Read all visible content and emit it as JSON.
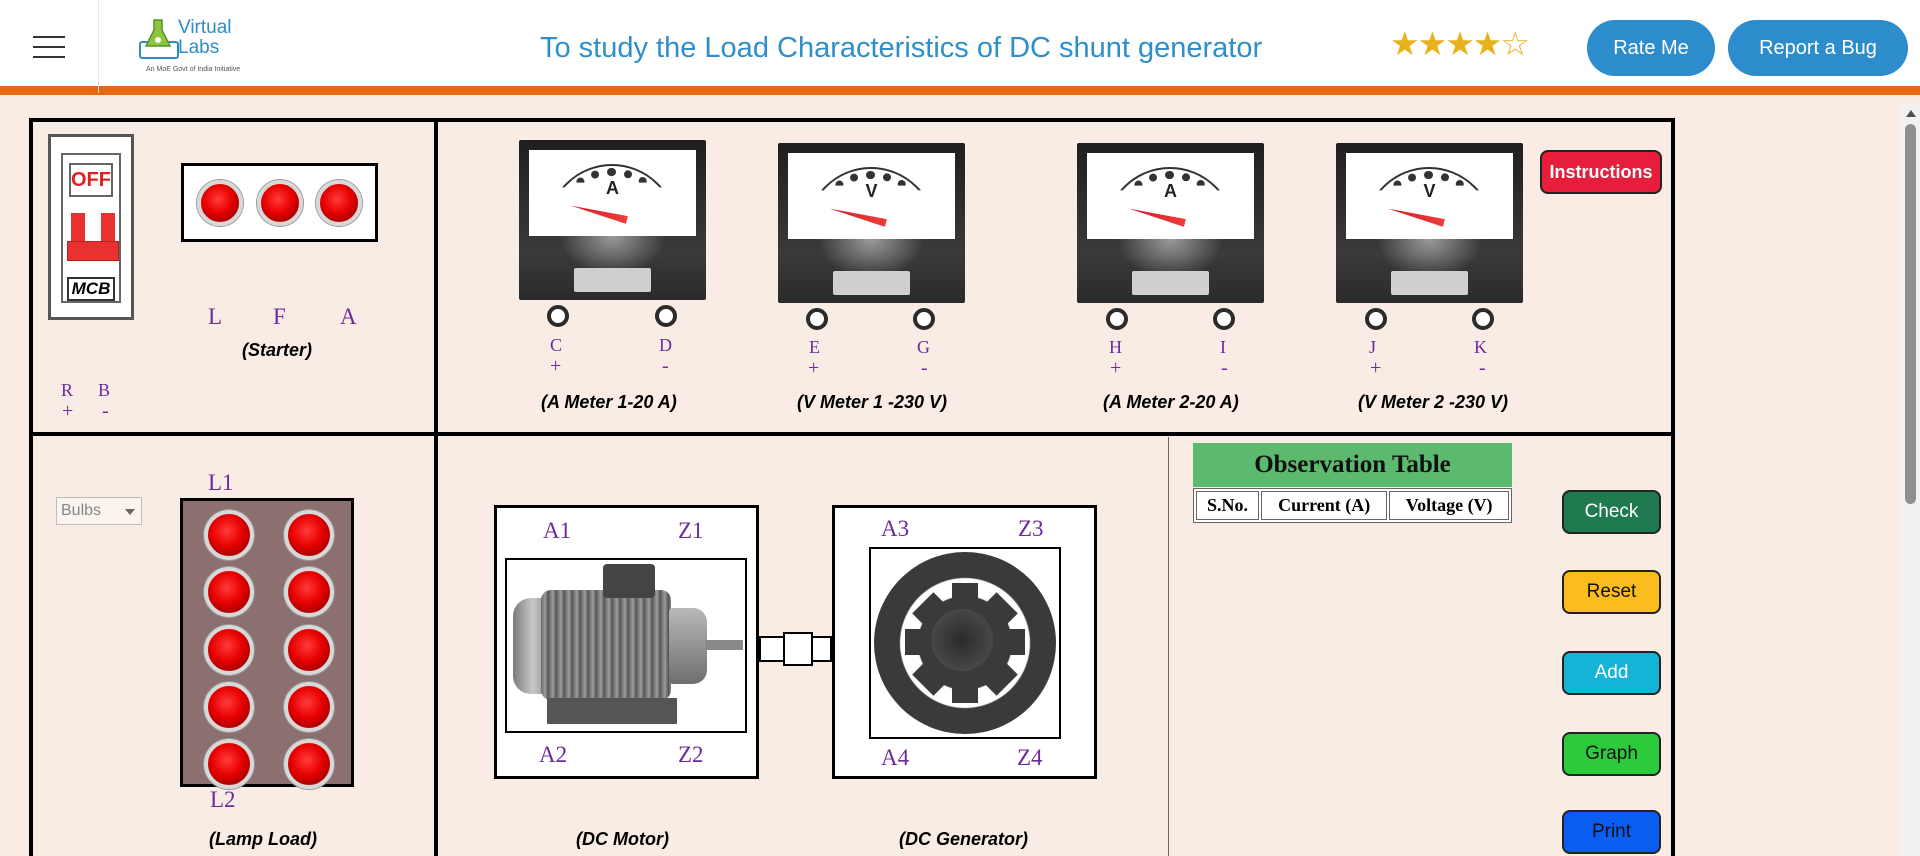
{
  "header": {
    "logo": {
      "brand": "Virtual Labs",
      "tagline": "An MoE Govt of India Initiative"
    },
    "title": "To study the Load Characteristics of DC shunt generator",
    "rating": {
      "filled": 4,
      "total": 5
    },
    "rate_button": "Rate Me",
    "bug_button": "Report a Bug"
  },
  "colors": {
    "accent": "#2d8ccb",
    "orange_bar": "#e8670c",
    "background": "#f8ece4"
  },
  "mcb": {
    "state": "OFF",
    "label": "MCB"
  },
  "starter": {
    "terminals": [
      "L",
      "F",
      "A"
    ],
    "caption": "(Starter)"
  },
  "supply": {
    "terminals": [
      "R",
      "B"
    ],
    "signs": [
      "+",
      "-"
    ]
  },
  "meters": [
    {
      "letter": "A",
      "terminals": [
        "C",
        "D"
      ],
      "signs": [
        "+",
        "-"
      ],
      "caption": "(A Meter 1-20 A)"
    },
    {
      "letter": "V",
      "terminals": [
        "E",
        "G"
      ],
      "signs": [
        "+",
        "-"
      ],
      "caption": "(V Meter 1 -230 V)"
    },
    {
      "letter": "A",
      "terminals": [
        "H",
        "I"
      ],
      "signs": [
        "+",
        "-"
      ],
      "caption": "(A Meter 2-20 A)"
    },
    {
      "letter": "V",
      "terminals": [
        "J",
        "K"
      ],
      "signs": [
        "+",
        "-"
      ],
      "caption": "(V Meter 2 -230 V)"
    }
  ],
  "instructions_button": "Instructions",
  "load": {
    "select_value": "Bulbs",
    "top_label": "L1",
    "bottom_label": "L2",
    "caption": "(Lamp Load)"
  },
  "motor": {
    "terminals": [
      "A1",
      "Z1",
      "A2",
      "Z2"
    ],
    "caption": "(DC Motor)"
  },
  "generator": {
    "terminals": [
      "A3",
      "Z3",
      "A4",
      "Z4"
    ],
    "caption": "(DC Generator)"
  },
  "observation": {
    "title": "Observation Table",
    "headers": [
      "S.No.",
      "Current (A)",
      "Voltage (V)"
    ]
  },
  "actions": {
    "check": "Check",
    "reset": "Reset",
    "add": "Add",
    "graph": "Graph",
    "print": "Print"
  }
}
